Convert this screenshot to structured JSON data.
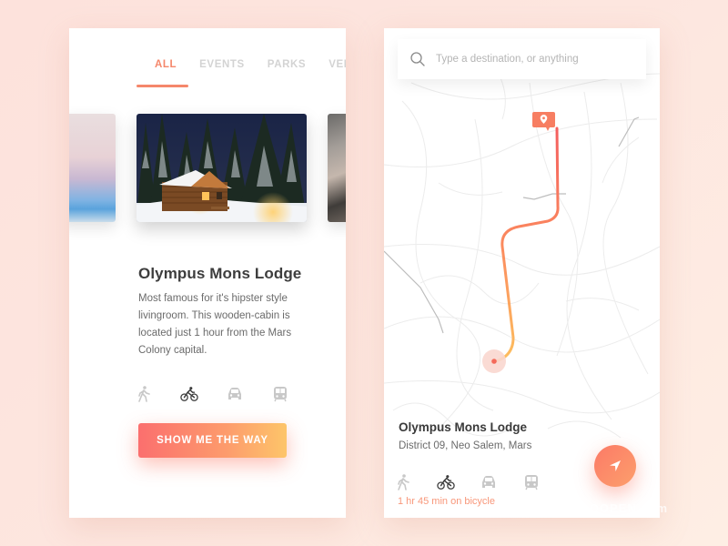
{
  "left_screen": {
    "tabs": [
      {
        "label": "ALL",
        "active": true
      },
      {
        "label": "EVENTS",
        "active": false
      },
      {
        "label": "PARKS",
        "active": false
      },
      {
        "label": "VENUES",
        "active": false
      }
    ],
    "carousel": {
      "items": [
        "sunset-lake-image",
        "snowy-wooden-cabin-image",
        "partial-photo-image"
      ],
      "active_index": 1
    },
    "place": {
      "title": "Olympus Mons Lodge",
      "description": "Most famous for it's hipster style livingroom. This wooden-cabin is located just 1 hour from the Mars Colony capital."
    },
    "transport_modes": [
      {
        "icon": "walk-icon",
        "selected": false
      },
      {
        "icon": "bicycle-icon",
        "selected": true
      },
      {
        "icon": "car-icon",
        "selected": false
      },
      {
        "icon": "train-icon",
        "selected": false
      }
    ],
    "cta_label": "SHOW ME THE WAY"
  },
  "right_screen": {
    "search": {
      "placeholder": "Type a destination, or anything",
      "value": ""
    },
    "map": {
      "destination_marker": "location-pin-icon",
      "origin_marker": "current-location-dot"
    },
    "place": {
      "title": "Olympus Mons Lodge",
      "address": "District 09, Neo Salem, Mars"
    },
    "transport_modes": [
      {
        "icon": "walk-icon",
        "selected": false
      },
      {
        "icon": "bicycle-icon",
        "selected": true
      },
      {
        "icon": "car-icon",
        "selected": false
      },
      {
        "icon": "train-icon",
        "selected": false
      }
    ],
    "eta": "1 hr 45 min on bicycle",
    "fab_icon": "navigate-arrow-icon"
  },
  "colors": {
    "accent": "#f5876b",
    "gradient_start": "#fb6f6e",
    "gradient_end": "#fdc56a",
    "inactive_tab": "#d3d3d3",
    "inactive_icon": "#c8c8c8",
    "active_icon": "#3a3a3a"
  },
  "watermark": "TOOOPEN.com"
}
